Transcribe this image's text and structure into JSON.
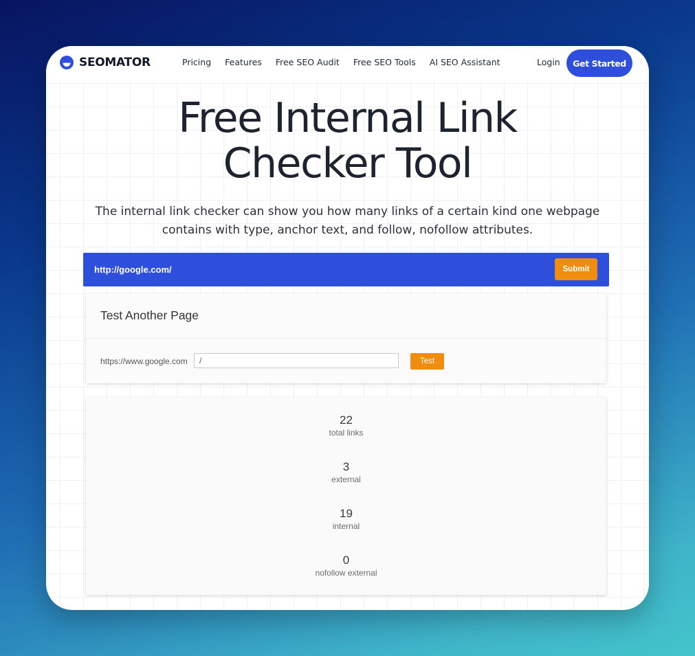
{
  "brand": {
    "name": "SEOMATOR",
    "accent_color": "#2d4fdc",
    "cta_color": "#f08c0e"
  },
  "nav": {
    "links": [
      "Pricing",
      "Features",
      "Free SEO Audit",
      "Free SEO Tools",
      "AI SEO Assistant"
    ],
    "login_label": "Login",
    "get_started_label": "Get Started"
  },
  "hero": {
    "title_line1": "Free Internal Link",
    "title_line2": "Checker Tool",
    "subtitle": "The internal link checker can show you how many links of a certain kind one webpage contains with type, anchor text, and follow, nofollow attributes."
  },
  "url_bar": {
    "value": "http://google.com/",
    "submit_label": "Submit"
  },
  "test_another": {
    "title": "Test Another Page",
    "domain": "https://www.google.com",
    "path_value": "/",
    "test_label": "Test"
  },
  "stats": [
    {
      "value": "22",
      "label": "total links"
    },
    {
      "value": "3",
      "label": "external"
    },
    {
      "value": "19",
      "label": "internal"
    },
    {
      "value": "0",
      "label": "nofollow external"
    }
  ]
}
